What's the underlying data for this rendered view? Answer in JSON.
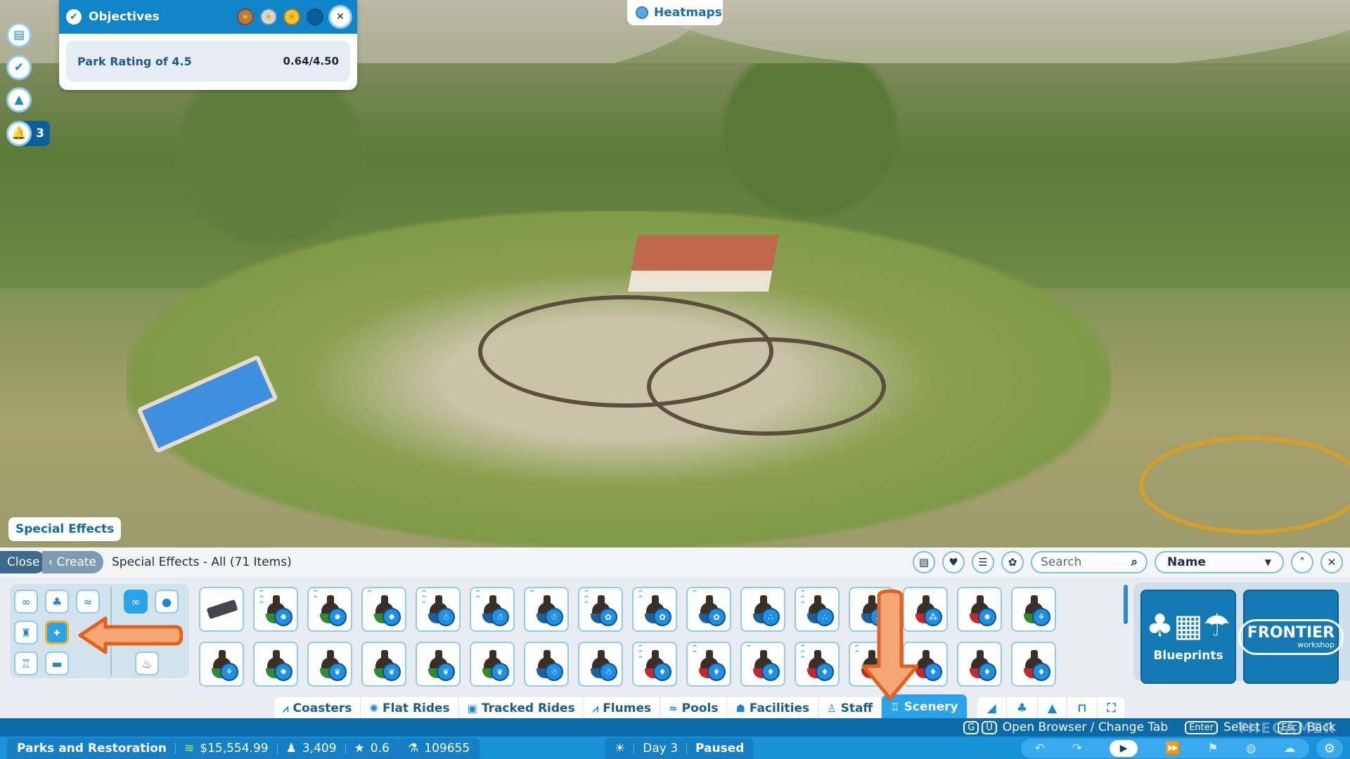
{
  "left_rail": {
    "buttons": [
      {
        "name": "clipboard-icon",
        "glyph": "▤"
      },
      {
        "name": "verified-check-icon",
        "glyph": "✔"
      },
      {
        "name": "terrain-add-icon",
        "glyph": "▲"
      },
      {
        "name": "bell-icon",
        "glyph": "🔔"
      }
    ],
    "notification_count": "3"
  },
  "objectives": {
    "title": "Objectives",
    "medals": [
      "bronze",
      "silver",
      "gold",
      "empty"
    ],
    "star_glyph": "★",
    "close_glyph": "✕",
    "row": {
      "label": "Park Rating of 4.5",
      "value": "0.64/4.50"
    }
  },
  "heatmaps": {
    "label": "Heatmaps"
  },
  "category_label": "Special Effects",
  "browser": {
    "close_label": "Close",
    "create_label": "‹ Create",
    "title": "Special Effects - All (71 Items)",
    "toolbar": {
      "search_placeholder": "Search",
      "search_glyph": "⌕",
      "sort_value": "Name",
      "sort_caret": "▼",
      "up_glyph": "˄",
      "close_glyph": "✕",
      "icons": [
        "▧",
        "♥",
        "☰",
        "✿"
      ]
    },
    "categories_left": [
      {
        "name": "infinity-icon",
        "glyph": "∞"
      },
      {
        "name": "tree-icon",
        "glyph": "♣"
      },
      {
        "name": "swan-boat-icon",
        "glyph": "≈"
      },
      {
        "name": "lamp-icon",
        "glyph": "♜"
      },
      {
        "name": "fireworks-icon",
        "glyph": "✦"
      },
      {
        "name": "castle-tower-icon",
        "glyph": "♖"
      },
      {
        "name": "sign-icon",
        "glyph": "▬"
      }
    ],
    "categories_right": [
      {
        "name": "infinity-icon",
        "glyph": "∞"
      },
      {
        "name": "water-drop-icon",
        "glyph": "●"
      },
      {
        "name": "fire-icon",
        "glyph": "♨"
      }
    ],
    "items_row1": [
      {
        "type": "tray",
        "base": "",
        "fx": "",
        "tier": ""
      },
      {
        "type": "nozzle",
        "base": "#2e8b2e",
        "fx": "✸",
        "tier": "3"
      },
      {
        "type": "nozzle",
        "base": "#2e8b2e",
        "fx": "✸",
        "tier": "2"
      },
      {
        "type": "nozzle",
        "base": "#2e8b2e",
        "fx": "✸",
        "tier": "1"
      },
      {
        "type": "nozzle",
        "base": "#1f5f9a",
        "fx": "☃",
        "tier": "3"
      },
      {
        "type": "nozzle",
        "base": "#1f5f9a",
        "fx": "☃",
        "tier": "2"
      },
      {
        "type": "nozzle",
        "base": "#1f5f9a",
        "fx": "☃",
        "tier": "1"
      },
      {
        "type": "nozzle",
        "base": "#1f5f9a",
        "fx": "✿",
        "tier": "3"
      },
      {
        "type": "nozzle",
        "base": "#1f5f9a",
        "fx": "✿",
        "tier": "2"
      },
      {
        "type": "nozzle",
        "base": "#1f5f9a",
        "fx": "✿",
        "tier": "1"
      },
      {
        "type": "nozzle",
        "base": "#1f5f9a",
        "fx": "∴",
        "tier": ""
      },
      {
        "type": "nozzle",
        "base": "#1f5f9a",
        "fx": "∴",
        "tier": "3"
      },
      {
        "type": "nozzle",
        "base": "#1f5f9a",
        "fx": "∴",
        "tier": ""
      },
      {
        "type": "nozzle",
        "base": "#c62828",
        "fx": "⁂",
        "tier": ""
      },
      {
        "type": "nozzle",
        "base": "#c62828",
        "fx": "✹",
        "tier": ""
      },
      {
        "type": "nozzle",
        "base": "#2e8b2e",
        "fx": "⚘",
        "tier": ""
      }
    ],
    "items_row2": [
      {
        "type": "nozzle",
        "base": "#2e8b2e",
        "fx": "⚘",
        "tier": ""
      },
      {
        "type": "nozzle",
        "base": "#2e8b2e",
        "fx": "✸",
        "tier": ""
      },
      {
        "type": "nozzle",
        "base": "#2e8b2e",
        "fx": "❦",
        "tier": ""
      },
      {
        "type": "nozzle",
        "base": "#2e8b2e",
        "fx": "❦",
        "tier": ""
      },
      {
        "type": "nozzle",
        "base": "#2e8b2e",
        "fx": "❦",
        "tier": ""
      },
      {
        "type": "nozzle",
        "base": "#2e8b2e",
        "fx": "❦",
        "tier": ""
      },
      {
        "type": "nozzle",
        "base": "#1f5f9a",
        "fx": "☃",
        "tier": ""
      },
      {
        "type": "nozzle",
        "base": "#1f5f9a",
        "fx": "☃",
        "tier": ""
      },
      {
        "type": "nozzle",
        "base": "#c62828",
        "fx": "♦",
        "tier": "3"
      },
      {
        "type": "nozzle",
        "base": "#c62828",
        "fx": "♦",
        "tier": "2"
      },
      {
        "type": "nozzle",
        "base": "#c62828",
        "fx": "♦",
        "tier": "1"
      },
      {
        "type": "nozzle",
        "base": "#c62828",
        "fx": "♦",
        "tier": "3"
      },
      {
        "type": "nozzle",
        "base": "#c62828",
        "fx": "♦",
        "tier": "2"
      },
      {
        "type": "nozzle",
        "base": "#c62828",
        "fx": "♦",
        "tier": ""
      },
      {
        "type": "nozzle",
        "base": "#c62828",
        "fx": "♦",
        "tier": ""
      },
      {
        "type": "nozzle",
        "base": "#c62828",
        "fx": "♦",
        "tier": ""
      }
    ],
    "blueprints": {
      "label": "Blueprints",
      "glyph": "♣▦☂"
    },
    "workshop": {
      "brand": "FRONTIER",
      "sub": "workshop"
    },
    "tabs": [
      {
        "label": "Coasters",
        "icon": "⩘",
        "name": "tab-coasters"
      },
      {
        "label": "Flat Rides",
        "icon": "✺",
        "name": "tab-flat-rides"
      },
      {
        "label": "Tracked Rides",
        "icon": "▣",
        "name": "tab-tracked-rides"
      },
      {
        "label": "Flumes",
        "icon": "⩘",
        "name": "tab-flumes"
      },
      {
        "label": "Pools",
        "icon": "≈",
        "name": "tab-pools"
      },
      {
        "label": "Facilities",
        "icon": "☗",
        "name": "tab-facilities"
      },
      {
        "label": "Staff",
        "icon": "♙",
        "name": "tab-staff"
      },
      {
        "label": "Scenery",
        "icon": "♖",
        "name": "tab-scenery",
        "active": true
      }
    ],
    "icon_tabs": [
      {
        "name": "tab-terrain-paint",
        "glyph": "◢"
      },
      {
        "name": "tab-landscape-trees",
        "glyph": "♣"
      },
      {
        "name": "tab-terrain",
        "glyph": "▲"
      },
      {
        "name": "tab-paths",
        "glyph": "⊓"
      },
      {
        "name": "tab-fullscreen",
        "glyph": "⛶"
      }
    ]
  },
  "hints": [
    {
      "keys": [
        "Ğ",
        "Ü"
      ],
      "text": "Open Browser / Change Tab"
    },
    {
      "keys": [
        "Enter"
      ],
      "text": "Select"
    },
    {
      "keys": [
        "Esc"
      ],
      "text": "Back"
    }
  ],
  "status": {
    "park_name": "Parks and Restoration",
    "money": "$15,554.99",
    "guests": "3,409",
    "rating": "0.6",
    "research": "109655",
    "weather_glyph": "☀",
    "day": "Day 3",
    "state": "Paused",
    "controls": [
      "↶",
      "↷",
      "▶",
      "⏩",
      "⚑",
      "◍",
      "☁"
    ],
    "gear_glyph": "⚙"
  },
  "watermark": "THEGAMER"
}
